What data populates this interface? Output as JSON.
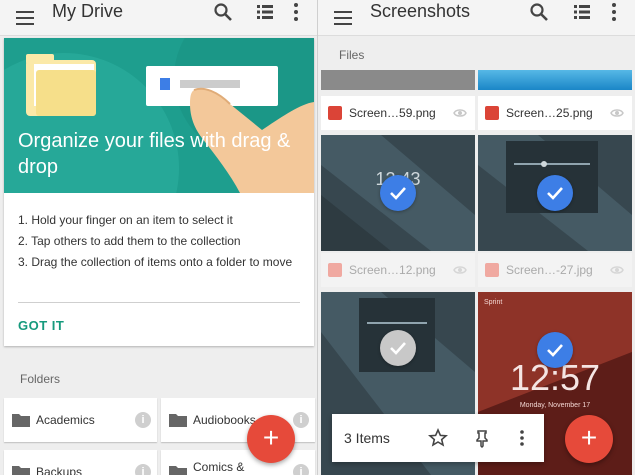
{
  "left": {
    "app_title": "My Drive",
    "promo": {
      "headline": "Organize your files with drag & drop",
      "steps": [
        "1. Hold your finger on an item to select it",
        "2. Tap others to add them to the collection",
        "3. Drag the collection of items onto a folder to move"
      ],
      "action_label": "GOT IT"
    },
    "folders_heading": "Folders",
    "folders": [
      "Academics",
      "Audiobooks",
      "Backups",
      "Comics &"
    ],
    "fab_label": "+"
  },
  "right": {
    "app_title": "Screenshots",
    "files_heading": "Files",
    "files": [
      {
        "name": "Screen…59.png",
        "dimmed": false
      },
      {
        "name": "Screen…25.png",
        "dimmed": false
      },
      {
        "name": "Screen…12.png",
        "dimmed": true
      },
      {
        "name": "Screen…-27.jpg",
        "dimmed": true
      }
    ],
    "thumb_texts": {
      "clock_small": "12:43",
      "clock_big": "12:57",
      "date": "Monday, November 17",
      "carrier": "Sprint"
    },
    "selection": {
      "count_label": "3 Items"
    },
    "fab_label": "+"
  },
  "colors": {
    "teal": "#1e9e8e",
    "accent_green": "#169a7d",
    "fab_red": "#e64a3a",
    "check_blue": "#3d7ee6",
    "image_red": "#db4437"
  }
}
